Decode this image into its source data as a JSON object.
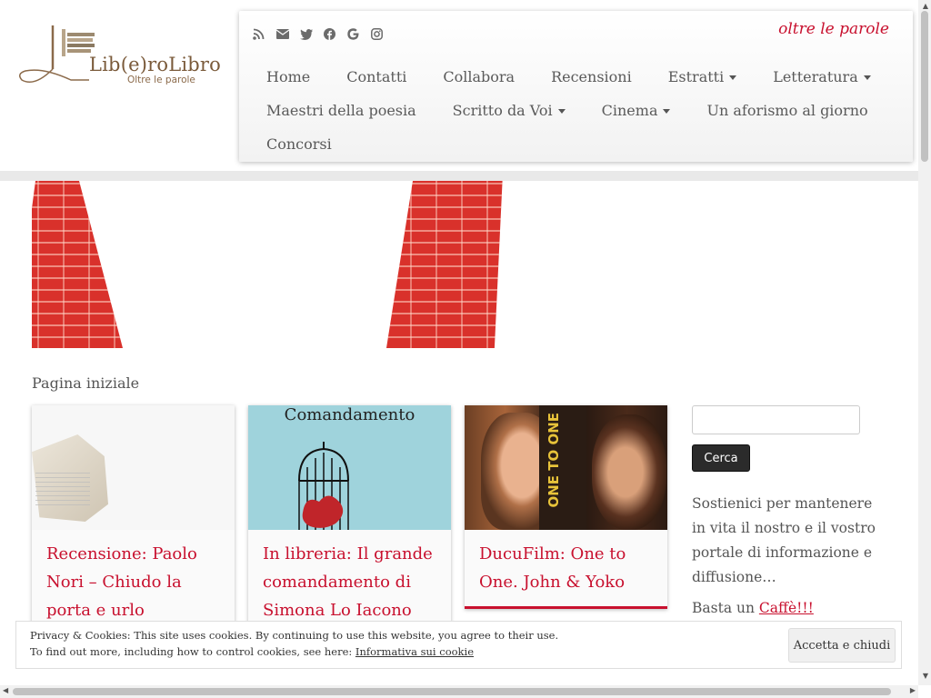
{
  "header": {
    "logo_title": "Lib(e)roLibro",
    "logo_subtitle": "Oltre le parole",
    "tagline": "oltre le parole",
    "social_icons": [
      "rss-icon",
      "email-icon",
      "twitter-icon",
      "facebook-icon",
      "google-icon",
      "instagram-icon"
    ]
  },
  "menu": {
    "row1": [
      {
        "label": "Home"
      },
      {
        "label": "Contatti"
      },
      {
        "label": "Collabora"
      },
      {
        "label": "Recensioni"
      },
      {
        "label": "Estratti"
      },
      {
        "label": "Letteratura"
      }
    ],
    "row2": [
      {
        "label": "Maestri della poesia"
      },
      {
        "label": "Scritto da Voi"
      },
      {
        "label": "Cinema"
      },
      {
        "label": "Un aforismo al giorno"
      }
    ],
    "row3": [
      {
        "label": "Concorsi"
      }
    ]
  },
  "main": {
    "page_label": "Pagina iniziale",
    "cards": [
      {
        "title": "Recensione: Paolo Nori – Chiudo la porta e urlo"
      },
      {
        "title": "In libreria: Il grande comandamento di Simona Lo Iacono",
        "image_text": "Comandamento"
      },
      {
        "title": "DucuFilm: One to One. John & Yoko",
        "image_text": "ONE TO ONE"
      }
    ]
  },
  "sidebar": {
    "search_value": "",
    "search_button": "Cerca",
    "support_text": "Sostienici per mantenere in vita il nostro e il vostro portale di informazione e diffusione…",
    "coffee_prefix": "Basta un ",
    "coffee_link": "Caffè!!!"
  },
  "cookie": {
    "line1": "Privacy & Cookies: This site uses cookies. By continuing to use this website, you agree to their use.",
    "line2_prefix": "To find out more, including how to control cookies, see here: ",
    "line2_link": "Informativa sui cookie",
    "button": "Accetta e chiudi"
  },
  "colors": {
    "accent": "#c8102e",
    "logo": "#7a5a3a",
    "button_dark": "#2b2b2b"
  }
}
